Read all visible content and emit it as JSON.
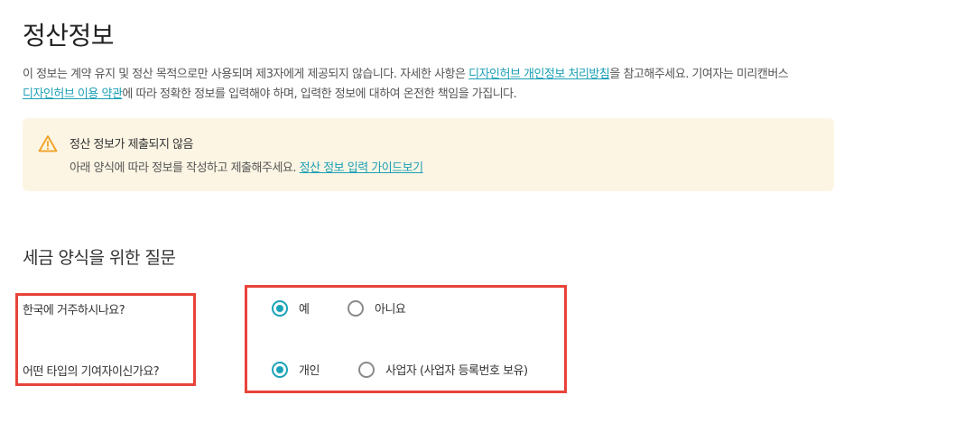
{
  "page_title": "정산정보",
  "description": {
    "part1": "이 정보는 계약 유지 및 정산 목적으로만 사용되며 제3자에게 제공되지 않습니다. 자세한 사항은 ",
    "privacy_link": "디자인허브 개인정보 처리방침",
    "part2": "을 참고해주세요. 기여자는 미리캔버스 ",
    "terms_link": "디자인허브 이용 약관",
    "part3": "에 따라 정확한 정보를 입력해야 하며, 입력한 정보에 대하여 온전한 책임을 가집니다."
  },
  "alert": {
    "icon": "warning-icon",
    "title": "정산 정보가 제출되지 않음",
    "body": "아래 양식에 따라 정보를 작성하고 제출해주세요. ",
    "guide_link": "정산 정보 입력 가이드보기",
    "color_bg": "#fdf5e4",
    "color_icon": "#f0a020"
  },
  "tax_section": {
    "title": "세금 양식을 위한 질문",
    "questions": [
      {
        "label": "한국에 거주하시나요?",
        "options": [
          {
            "label": "예",
            "selected": true
          },
          {
            "label": "아니요",
            "selected": false
          }
        ]
      },
      {
        "label": "어떤 타입의 기여자이신가요?",
        "options": [
          {
            "label": "개인",
            "selected": true
          },
          {
            "label": "사업자 (사업자 등록번호 보유)",
            "selected": false
          }
        ]
      }
    ]
  },
  "colors": {
    "accent": "#1aa3b8",
    "highlight_box": "#e8433a"
  }
}
